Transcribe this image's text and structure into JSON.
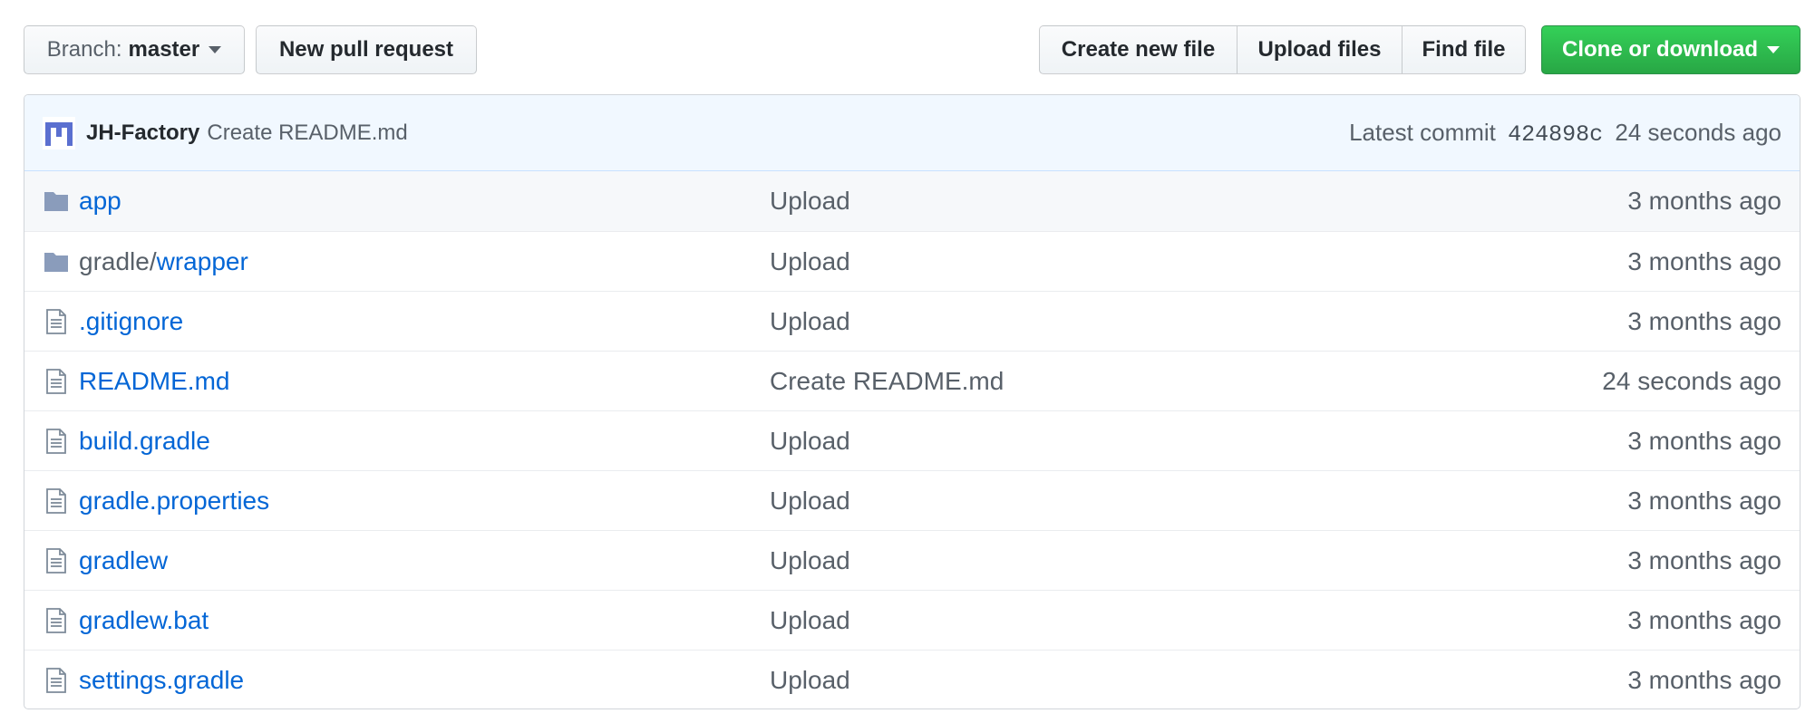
{
  "toolbar": {
    "branch_prefix": "Branch:",
    "branch_name": "master",
    "new_pull_request": "New pull request",
    "create_new_file": "Create new file",
    "upload_files": "Upload files",
    "find_file": "Find file",
    "clone_or_download": "Clone or download"
  },
  "commit": {
    "author": "JH-Factory",
    "message": "Create README.md",
    "label": "Latest commit",
    "sha": "424898c",
    "age": "24 seconds ago"
  },
  "files": [
    {
      "type": "dir",
      "prefix": "",
      "name": "app",
      "message": "Upload",
      "age": "3 months ago"
    },
    {
      "type": "dir",
      "prefix": "gradle/",
      "name": "wrapper",
      "message": "Upload",
      "age": "3 months ago"
    },
    {
      "type": "file",
      "prefix": "",
      "name": ".gitignore",
      "message": "Upload",
      "age": "3 months ago"
    },
    {
      "type": "file",
      "prefix": "",
      "name": "README.md",
      "message": "Create README.md",
      "age": "24 seconds ago"
    },
    {
      "type": "file",
      "prefix": "",
      "name": "build.gradle",
      "message": "Upload",
      "age": "3 months ago"
    },
    {
      "type": "file",
      "prefix": "",
      "name": "gradle.properties",
      "message": "Upload",
      "age": "3 months ago"
    },
    {
      "type": "file",
      "prefix": "",
      "name": "gradlew",
      "message": "Upload",
      "age": "3 months ago"
    },
    {
      "type": "file",
      "prefix": "",
      "name": "gradlew.bat",
      "message": "Upload",
      "age": "3 months ago"
    },
    {
      "type": "file",
      "prefix": "",
      "name": "settings.gradle",
      "message": "Upload",
      "age": "3 months ago"
    }
  ],
  "colors": {
    "link": "#0366d6",
    "muted": "#586069",
    "primary_button": "#28a745",
    "commit_bar_bg": "#f1f8ff",
    "folder_icon": "#79b8ff"
  },
  "icons": {
    "dir": "folder-icon",
    "file": "file-text-icon",
    "avatar": "jh-factory-avatar"
  }
}
